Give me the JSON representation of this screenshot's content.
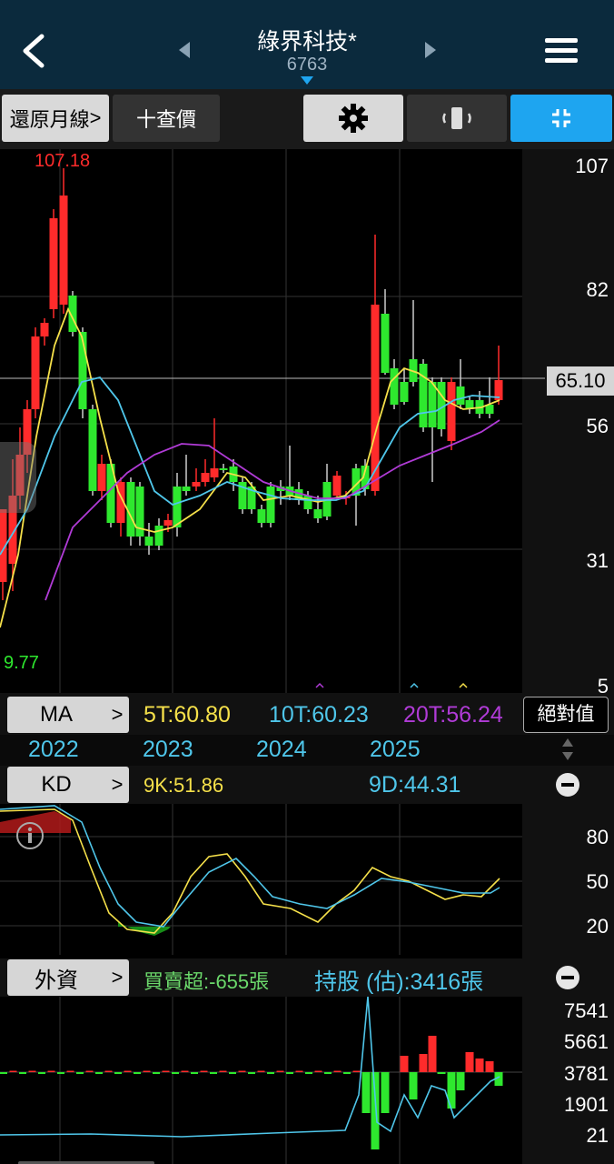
{
  "header": {
    "title": "綠界科技*",
    "code": "6763"
  },
  "toolbar": {
    "restore_label": "還原月線",
    "restore_arrow": ">",
    "query_label": "十查價"
  },
  "price_axis": {
    "ticks": [
      "107",
      "82",
      "56",
      "31",
      "5"
    ],
    "current_price": "65.10",
    "high_label": "107.18",
    "low_label": "9.77"
  },
  "ma_panel": {
    "button_label": "MA",
    "ma5": "5T:60.80",
    "ma10": "10T:60.23",
    "ma20": "20T:56.24",
    "absolute_button": "絕對值",
    "colors": {
      "ma5": "#f5e04a",
      "ma10": "#4fc6ea",
      "ma20": "#b03bd6"
    }
  },
  "years": [
    "2022",
    "2023",
    "2024",
    "2025"
  ],
  "kd_panel": {
    "button_label": "KD",
    "k_value": "9K:51.86",
    "d_value": "9D:44.31",
    "ticks": [
      "80",
      "50",
      "20"
    ],
    "colors": {
      "k": "#f5e04a",
      "d": "#4fc6ea"
    }
  },
  "foreign_panel": {
    "button_label": "外資",
    "net_label": "買賣超:-655張",
    "holding_label": "持股 (估):3416張",
    "ticks": [
      "7541",
      "5661",
      "3781",
      "1901",
      "21"
    ],
    "colors": {
      "net": "#6bd86b",
      "holding": "#4fc6ea"
    }
  },
  "colors": {
    "up": "#ff2b2b",
    "down": "#2ee82e",
    "accent": "#1ea5f0"
  },
  "icons": [
    "back-arrow-icon",
    "menu-icon",
    "gear-icon",
    "rotate-icon",
    "fullscreen-icon",
    "info-icon"
  ]
}
